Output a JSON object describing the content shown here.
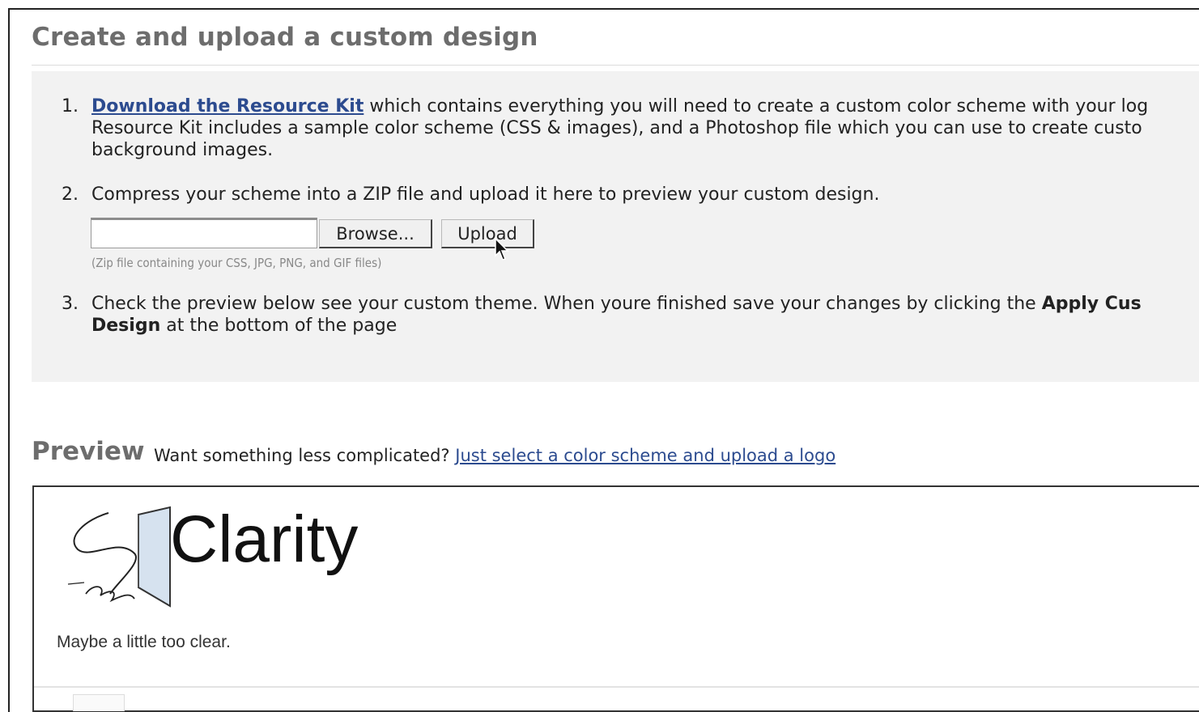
{
  "section_title": "Create and upload a custom design",
  "steps": [
    {
      "number": "1.",
      "link": "Download the Resource Kit",
      "line1_rest": " which contains everything you will need to create a custom color scheme with your log",
      "line2": "Resource Kit includes a sample color scheme (CSS & images), and a Photoshop file which you can use to create custo",
      "line3": "background images."
    },
    {
      "number": "2.",
      "text": "Compress your scheme into a ZIP file and upload it here to preview your custom design."
    },
    {
      "number": "3.",
      "line1_a": "Check the preview below see your custom theme. When youre finished save your changes by clicking the ",
      "line1_bold": "Apply Cus",
      "line2_bold": "Design",
      "line2_rest": " at the bottom of the page"
    }
  ],
  "upload": {
    "file_value": "",
    "browse_label": "Browse...",
    "upload_label": "Upload",
    "hint": "(Zip file containing your CSS, JPG, PNG, and GIF files)"
  },
  "preview": {
    "heading": "Preview",
    "prompt": "Want something less complicated?",
    "alt_link": "Just select a color scheme and upload a logo",
    "logo_text": "Clarity",
    "tagline": "Maybe a little too clear."
  },
  "colors": {
    "link": "#2c4b8f",
    "panel_bg": "#f2f2f2",
    "heading_gray": "#6d6d6d"
  }
}
